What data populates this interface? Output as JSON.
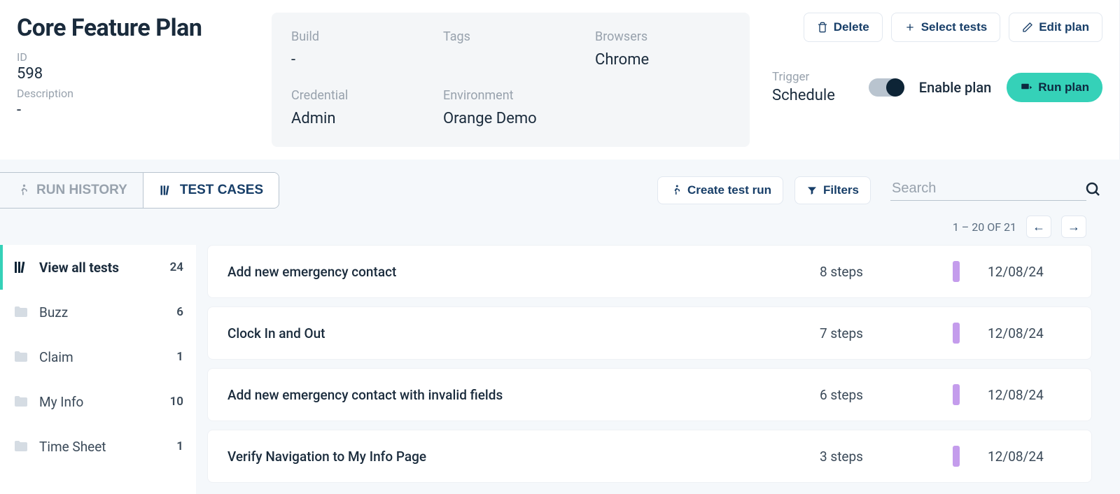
{
  "plan": {
    "title": "Core Feature Plan",
    "id_label": "ID",
    "id_value": "598",
    "description_label": "Description",
    "description_value": "-"
  },
  "meta": {
    "build": {
      "label": "Build",
      "value": "-"
    },
    "tags": {
      "label": "Tags",
      "value": ""
    },
    "browsers": {
      "label": "Browsers",
      "value": "Chrome"
    },
    "credential": {
      "label": "Credential",
      "value": "Admin"
    },
    "environment": {
      "label": "Environment",
      "value": "Orange Demo"
    }
  },
  "actions": {
    "delete": "Delete",
    "select_tests": "Select tests",
    "edit_plan": "Edit plan",
    "trigger_label": "Trigger",
    "trigger_value": "Schedule",
    "enable_plan": "Enable plan",
    "run_plan": "Run plan"
  },
  "tabs": {
    "run_history": "RUN HISTORY",
    "test_cases": "TEST CASES"
  },
  "toolbar": {
    "create_test_run": "Create test run",
    "filters": "Filters",
    "search_placeholder": "Search",
    "pagination": "1 – 20 OF 21"
  },
  "sidebar": {
    "view_all": {
      "label": "View all tests",
      "count": "24"
    },
    "folders": [
      {
        "label": "Buzz",
        "count": "6"
      },
      {
        "label": "Claim",
        "count": "1"
      },
      {
        "label": "My Info",
        "count": "10"
      },
      {
        "label": "Time Sheet",
        "count": "1"
      }
    ]
  },
  "tests": [
    {
      "name": "Add new emergency contact",
      "steps": "8 steps",
      "date": "12/08/24"
    },
    {
      "name": "Clock In and Out",
      "steps": "7 steps",
      "date": "12/08/24"
    },
    {
      "name": "Add new emergency contact with invalid fields",
      "steps": "6 steps",
      "date": "12/08/24"
    },
    {
      "name": "Verify Navigation to My Info Page",
      "steps": "3 steps",
      "date": "12/08/24"
    }
  ],
  "colors": {
    "accent_green": "#35d1b8",
    "accent_purple": "#c49cec"
  }
}
